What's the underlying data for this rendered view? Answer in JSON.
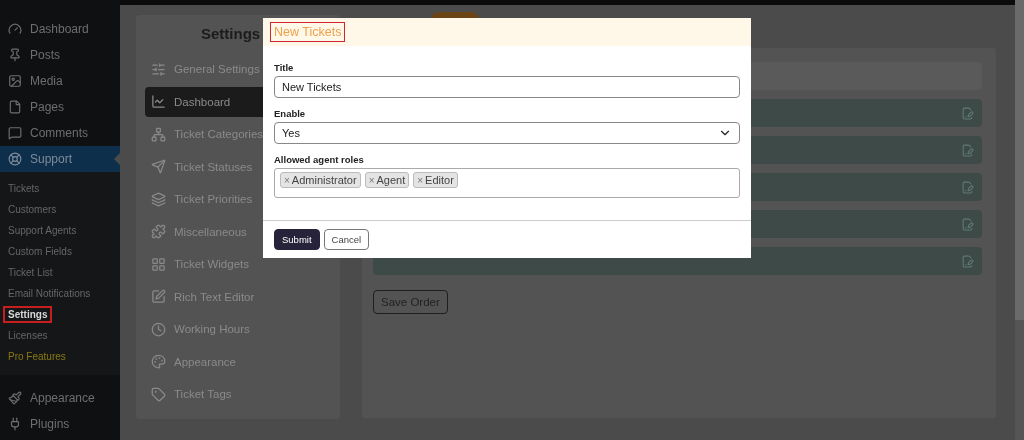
{
  "admin_menu": {
    "items": [
      {
        "label": "Dashboard",
        "selected": false
      },
      {
        "label": "Posts",
        "selected": false
      },
      {
        "label": "Media",
        "selected": false
      },
      {
        "label": "Pages",
        "selected": false
      },
      {
        "label": "Comments",
        "selected": false
      },
      {
        "label": "Support",
        "selected": true,
        "children": [
          {
            "label": "Tickets",
            "selected": false,
            "annotated": false,
            "kind": "normal"
          },
          {
            "label": "Customers",
            "selected": false,
            "annotated": false,
            "kind": "normal"
          },
          {
            "label": "Support Agents",
            "selected": false,
            "annotated": false,
            "kind": "normal"
          },
          {
            "label": "Custom Fields",
            "selected": false,
            "annotated": false,
            "kind": "normal"
          },
          {
            "label": "Ticket List",
            "selected": false,
            "annotated": false,
            "kind": "normal"
          },
          {
            "label": "Email Notifications",
            "selected": false,
            "annotated": false,
            "kind": "normal"
          },
          {
            "label": "Settings",
            "selected": true,
            "annotated": true,
            "kind": "normal"
          },
          {
            "label": "Licenses",
            "selected": false,
            "annotated": false,
            "kind": "normal"
          },
          {
            "label": "Pro Features",
            "selected": false,
            "annotated": false,
            "kind": "promo"
          }
        ]
      },
      {
        "label": "Appearance",
        "selected": false
      },
      {
        "label": "Plugins",
        "selected": false
      }
    ]
  },
  "settings_panel": {
    "title": "Settings",
    "items": [
      {
        "label": "General Settings",
        "selected": false
      },
      {
        "label": "Dashboard",
        "selected": true
      },
      {
        "label": "Ticket Categories",
        "selected": false
      },
      {
        "label": "Ticket Statuses",
        "selected": false
      },
      {
        "label": "Ticket Priorities",
        "selected": false
      },
      {
        "label": "Miscellaneous",
        "selected": false
      },
      {
        "label": "Ticket Widgets",
        "selected": false
      },
      {
        "label": "Rich Text Editor",
        "selected": false
      },
      {
        "label": "Working Hours",
        "selected": false
      },
      {
        "label": "Appearance",
        "selected": false
      },
      {
        "label": "Ticket Tags",
        "selected": false
      }
    ]
  },
  "widget_list": {
    "rows": [
      {
        "kind": "header"
      },
      {
        "kind": "widget"
      },
      {
        "kind": "widget"
      },
      {
        "kind": "widget"
      },
      {
        "kind": "widget"
      },
      {
        "kind": "widget"
      }
    ],
    "save_button": "Save Order"
  },
  "modal": {
    "title": "New Tickets",
    "title_annotated": true,
    "fields": [
      {
        "kind": "text",
        "label": "Title",
        "value": "New Tickets"
      },
      {
        "kind": "select",
        "label": "Enable",
        "value": "Yes"
      },
      {
        "kind": "tags",
        "label": "Allowed agent roles",
        "tags": [
          "Administrator",
          "Agent",
          "Editor"
        ],
        "remove_symbol": "×"
      }
    ],
    "buttons": [
      {
        "label": "Submit",
        "kind": "primary"
      },
      {
        "label": "Cancel",
        "kind": "secondary"
      }
    ]
  }
}
